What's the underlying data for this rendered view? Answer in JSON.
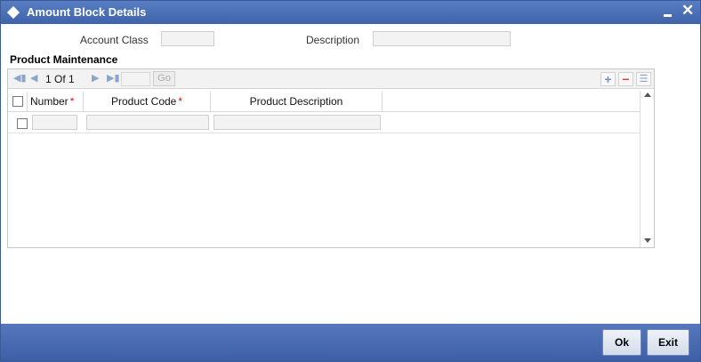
{
  "window": {
    "title": "Amount Block Details",
    "minimize_label": "–",
    "close_label": "✕",
    "icons": {
      "title": "diamond-icon",
      "minimize": "minimize-icon",
      "close": "close-icon"
    }
  },
  "form": {
    "account_class_label": "Account Class",
    "account_class_value": "",
    "description_label": "Description",
    "description_value": ""
  },
  "product_maintenance": {
    "title": "Product Maintenance",
    "pagination": {
      "current_page": "1",
      "of_label": "Of",
      "total_pages": "1",
      "page_input_value": "",
      "go_label": "Go",
      "icons": [
        "first-page-icon",
        "previous-page-icon",
        "next-page-icon",
        "last-page-icon"
      ]
    },
    "row_actions": {
      "add_label": "+",
      "delete_label": "−",
      "single_view_label": "☰"
    },
    "columns": [
      {
        "label": "Number",
        "required": true
      },
      {
        "label": "Product Code",
        "required": true
      },
      {
        "label": "Product Description",
        "required": false
      }
    ],
    "required_marker": "*",
    "rows": [
      {
        "selected": false,
        "number": "",
        "product_code": "",
        "product_description": ""
      }
    ]
  },
  "footer": {
    "ok_label": "Ok",
    "exit_label": "Exit"
  },
  "colors": {
    "titlebar": "#4a6eb5",
    "footer": "#4a6cb2",
    "required": "#dd1111",
    "field_bg": "#f3f3f3"
  }
}
